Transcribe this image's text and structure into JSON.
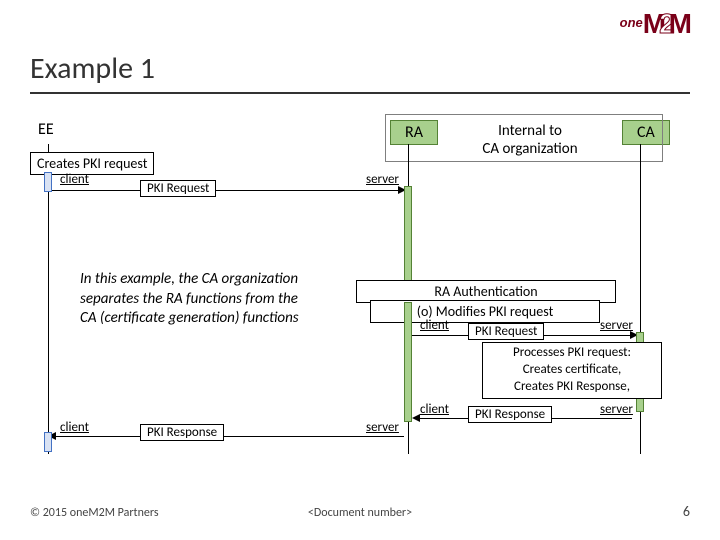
{
  "logo": {
    "part1": "one",
    "part2": "M",
    "part3": "2",
    "part4": "M"
  },
  "title": "Example 1",
  "actors": {
    "ee": "EE",
    "ra": "RA",
    "ca": "CA",
    "internal": "Internal to\nCA organization"
  },
  "notes": {
    "create": "Creates PKI request",
    "explain": "In this example, the  CA organization separates the RA functions from the  CA (certificate generation) functions",
    "ra_auth": "RA Authentication",
    "modifies": "(o) Modifies PKI request",
    "processes": "Processes PKI request:\nCreates certificate,\nCreates PKI Response,"
  },
  "roles": {
    "client": "client",
    "server": "server"
  },
  "messages": {
    "req": "PKI Request",
    "resp": "PKI Response"
  },
  "colors": {
    "ee_border": "#4472c4",
    "ee_fill": "#d9e2f3",
    "ra_ca_border": "#548235",
    "ra_ca_fill": "#a8d08d",
    "activ_blue": "#d9e2f3",
    "activ_green": "#a8d08d"
  },
  "footer": {
    "left": "© 2015 oneM2M Partners",
    "center": "<Document number>",
    "page": "6"
  }
}
